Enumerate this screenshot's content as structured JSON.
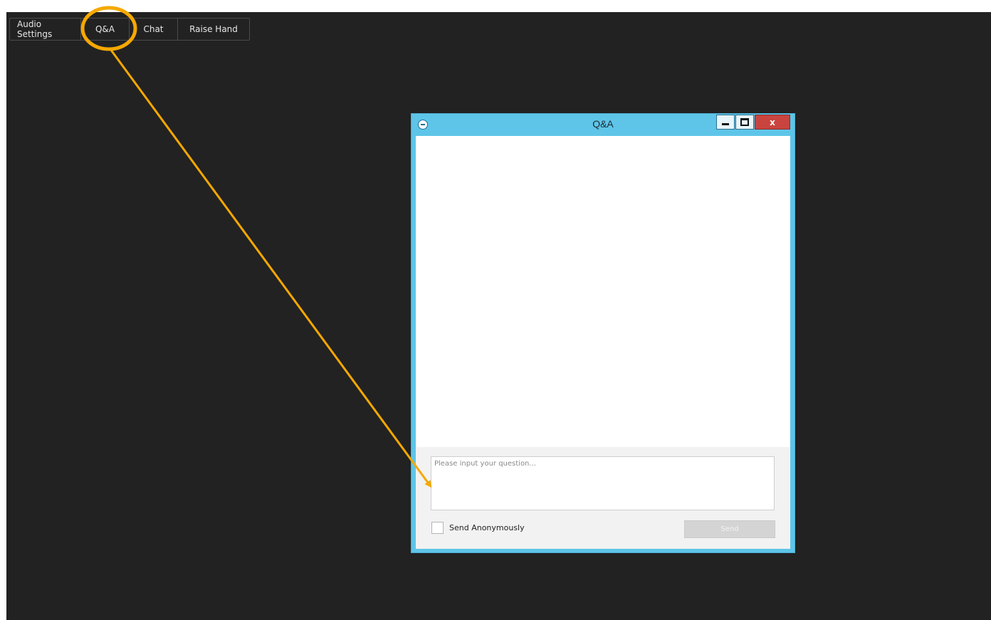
{
  "toolbar": {
    "items": [
      {
        "label": "Audio Settings"
      },
      {
        "label": "Q&A"
      },
      {
        "label": "Chat"
      },
      {
        "label": "Raise Hand"
      }
    ]
  },
  "qa_window": {
    "title": "Q&A",
    "close_label": "x",
    "input_placeholder": "Please input your question...",
    "input_value": "",
    "anonymous_label": "Send Anonymously",
    "anonymous_checked": false,
    "send_label": "Send"
  },
  "colors": {
    "background": "#222222",
    "window_frame": "#5ec5e8",
    "annotation": "#f5a800",
    "close_button": "#c9443f"
  }
}
